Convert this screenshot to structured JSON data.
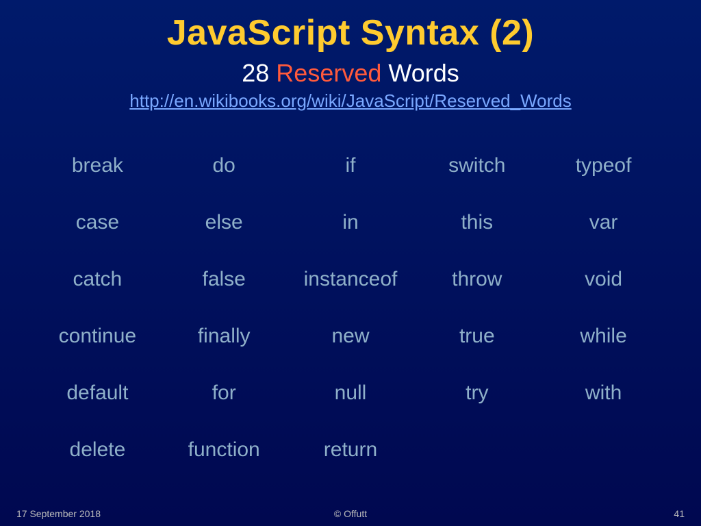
{
  "title": "JavaScript Syntax (2)",
  "subtitle_prefix": "28 ",
  "subtitle_accent": "Reserved",
  "subtitle_suffix": " Words",
  "link": "http://en.wikibooks.org/wiki/JavaScript/Reserved_Words",
  "reserved_words": [
    [
      "break",
      "do",
      "if",
      "switch",
      "typeof"
    ],
    [
      "case",
      "else",
      "in",
      "this",
      "var"
    ],
    [
      "catch",
      "false",
      "instanceof",
      "throw",
      "void"
    ],
    [
      "continue",
      "finally",
      "new",
      "true",
      "while"
    ],
    [
      "default",
      "for",
      "null",
      "try",
      "with"
    ],
    [
      "delete",
      "function",
      "return",
      "",
      ""
    ]
  ],
  "footer": {
    "date": "17 September 2018",
    "copyright": "©  Offutt",
    "page": "41"
  },
  "chart_data": {
    "type": "table",
    "title": "28 Reserved Words",
    "columns": 5,
    "rows": 6,
    "cells": [
      [
        "break",
        "do",
        "if",
        "switch",
        "typeof"
      ],
      [
        "case",
        "else",
        "in",
        "this",
        "var"
      ],
      [
        "catch",
        "false",
        "instanceof",
        "throw",
        "void"
      ],
      [
        "continue",
        "finally",
        "new",
        "true",
        "while"
      ],
      [
        "default",
        "for",
        "null",
        "try",
        "with"
      ],
      [
        "delete",
        "function",
        "return",
        "",
        ""
      ]
    ]
  }
}
